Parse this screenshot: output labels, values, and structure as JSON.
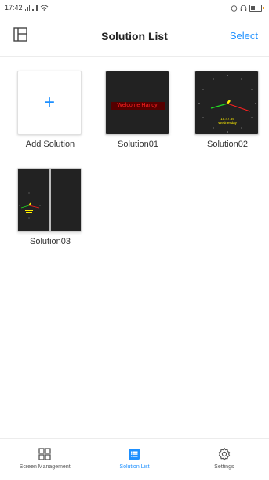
{
  "status_bar": {
    "time": "17:42"
  },
  "header": {
    "title": "Solution List",
    "select_label": "Select"
  },
  "tiles": [
    {
      "label": "Add Solution"
    },
    {
      "label": "Solution01",
      "preview_text": "Welcome Handy!"
    },
    {
      "label": "Solution02",
      "preview_text_1": "15:47:59",
      "preview_text_2": "Wednesday"
    },
    {
      "label": "Solution03"
    }
  ],
  "bottom_nav": {
    "items": [
      {
        "label": "Screen Management",
        "icon": "grid-icon"
      },
      {
        "label": "Solution List",
        "icon": "list-icon",
        "active": true
      },
      {
        "label": "Settings",
        "icon": "gear-icon"
      }
    ]
  },
  "colors": {
    "accent": "#1e90ff",
    "tile_dark": "#222222",
    "preview_red": "#ff2020"
  }
}
